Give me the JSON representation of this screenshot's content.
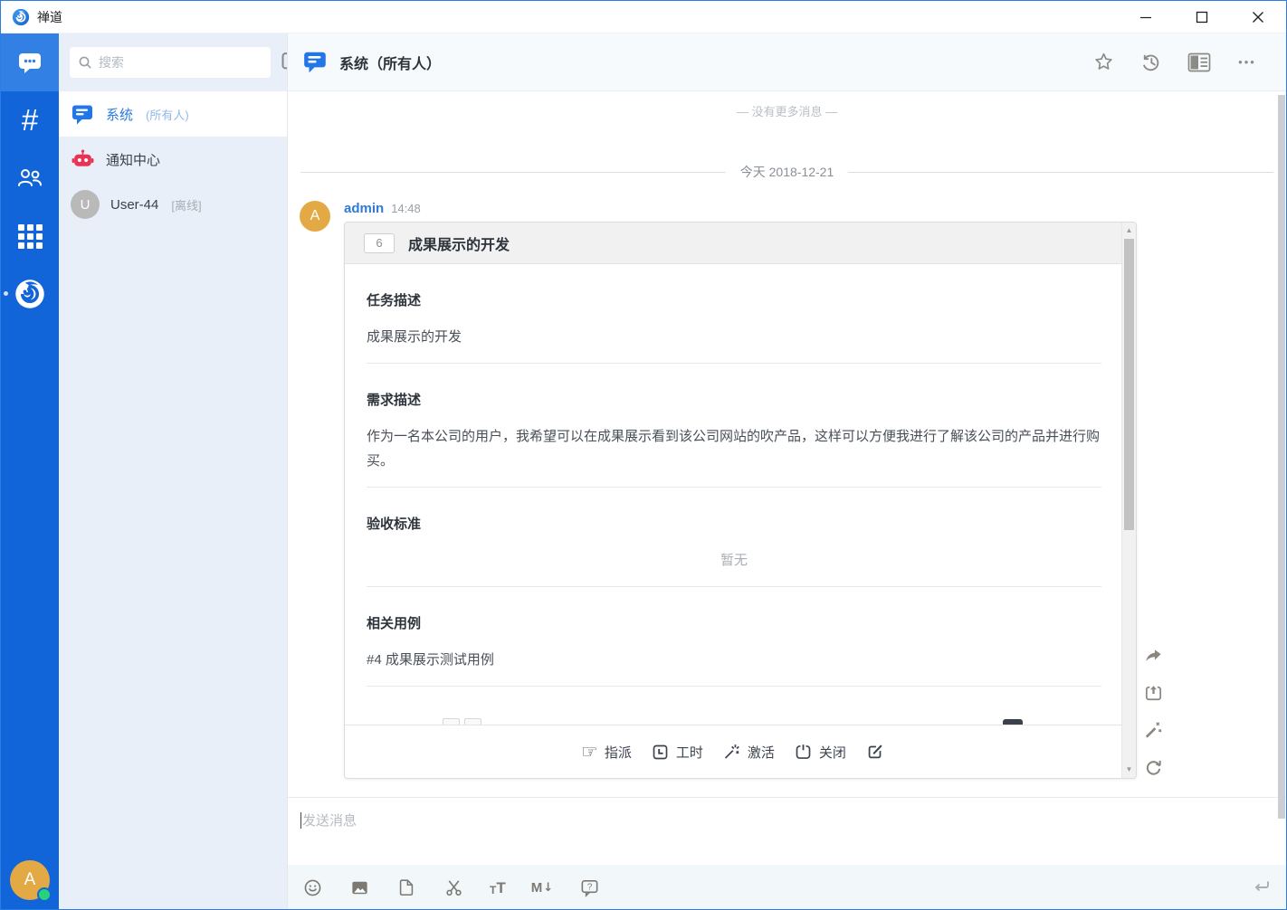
{
  "window": {
    "title": "禅道"
  },
  "nav_rail": {
    "user_initial": "A",
    "items": [
      "chat",
      "channels",
      "contacts",
      "apps",
      "zentao-logo"
    ]
  },
  "sidebar": {
    "search_placeholder": "搜索",
    "items": [
      {
        "title": "系统",
        "suffix": "(所有人)",
        "active": true
      },
      {
        "title": "通知中心",
        "suffix": ""
      },
      {
        "title": "User-44",
        "suffix": "[离线]",
        "avatar": "U"
      }
    ]
  },
  "chat": {
    "title": "系统（所有人）",
    "no_more_text": "— 没有更多消息 —",
    "date_divider": "今天 2018-12-21",
    "message": {
      "sender": "admin",
      "time": "14:48",
      "avatar_initial": "A"
    },
    "card": {
      "badge": "6",
      "title": "成果展示的开发",
      "sections": [
        {
          "heading": "任务描述",
          "content": "成果展示的开发"
        },
        {
          "heading": "需求描述",
          "content": "作为一名本公司的用户，我希望可以在成果展示看到该公司网站的吹产品，这样可以方便我进行了解该公司的产品并进行购买。"
        },
        {
          "heading": "验收标准",
          "content": "暂无"
        },
        {
          "heading": "相关用例",
          "content": "#4 成果展示测试用例"
        }
      ],
      "actions": [
        {
          "label": "指派"
        },
        {
          "label": "工时"
        },
        {
          "label": "激活"
        },
        {
          "label": "关闭"
        }
      ]
    },
    "composer": {
      "placeholder": "发送消息"
    }
  },
  "glyphs": {
    "ellipsis": "•••",
    "assign_pointer": "☞",
    "scroll_up": "▲",
    "scroll_down": "▼",
    "tt_small": "T",
    "tt_big": "T",
    "md_letter": "M",
    "md_arrow": "↓"
  },
  "colors": {
    "rail_blue": "#1165d8",
    "rail_active_blue": "#3380e4",
    "accent_blue": "#2376e8",
    "notification_red": "#ea3352",
    "avatar_gold": "#e3a944",
    "online_green": "#28d17c"
  }
}
